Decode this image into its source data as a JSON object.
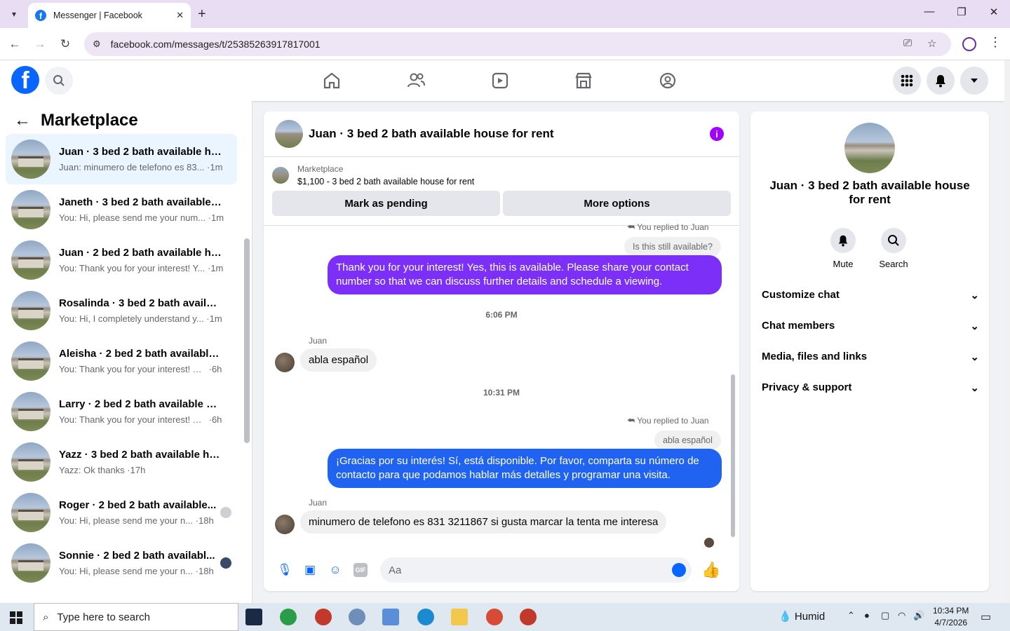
{
  "browser": {
    "tab_title": "Messenger | Facebook",
    "url": "facebook.com/messages/t/25385263917817001"
  },
  "left": {
    "title": "Marketplace",
    "conversations": [
      {
        "name": "Juan · 3 bed 2 bath available ho...",
        "preview": "Juan: minumero de telefono es 83...",
        "time": "1m",
        "active": true
      },
      {
        "name": "Janeth · 3 bed 2 bath available h...",
        "preview": "You: Hi, please send me your num...",
        "time": "1m"
      },
      {
        "name": "Juan · 2 bed 2 bath available ho...",
        "preview": "You: Thank you for your interest! Y...",
        "time": "1m"
      },
      {
        "name": "Rosalinda · 3 bed 2 bath availabl...",
        "preview": "You: Hi, I completely understand y...",
        "time": "1m"
      },
      {
        "name": "Aleisha · 2 bed 2 bath available ...",
        "preview": "You: Thank you for your interest! Ye...",
        "time": "6h"
      },
      {
        "name": "Larry · 2 bed 2 bath available ho...",
        "preview": "You: Thank you for your interest! Ye...",
        "time": "6h"
      },
      {
        "name": "Yazz · 3 bed 2 bath available ho...",
        "preview": "Yazz: Ok thanks",
        "time": "17h"
      },
      {
        "name": "Roger · 2 bed 2 bath available...",
        "preview": "You: Hi, please send me your n...",
        "time": "18h"
      },
      {
        "name": "Sonnie · 2 bed 2 bath availabl...",
        "preview": "You: Hi, please send me your n...",
        "time": "18h"
      }
    ]
  },
  "chat": {
    "title": "Juan · 3 bed 2 bath available house for rent",
    "listing_source": "Marketplace",
    "listing_text": "$1,100 - 3 bed 2 bath available house for rent",
    "btn_pending": "Mark as pending",
    "btn_more": "More options",
    "reply_label_1": "You replied to Juan",
    "quoted_1": "Is this still available?",
    "out_1": "Thank you for your interest! Yes, this is available. Please share your contact number so that we can discuss further details and schedule a viewing.",
    "time_1": "6:06 PM",
    "sender_1": "Juan",
    "in_1": "abla español",
    "time_2": "10:31 PM",
    "reply_label_2": "You replied to Juan",
    "quoted_2": "abla español",
    "out_2": "¡Gracias por su interés! Sí, está disponible. Por favor, comparta su número de contacto para que podamos hablar más detalles y programar una visita.",
    "sender_2": "Juan",
    "in_2": "minumero de telefono es 831 3211867 si gusta marcar la tenta me interesa",
    "composer_placeholder": "Aa",
    "out_color_1": "#7b2ff7",
    "out_color_2": "#1f63f0"
  },
  "right": {
    "name": "Juan · 3 bed 2 bath available house for rent",
    "mute": "Mute",
    "search": "Search",
    "sections": [
      "Customize chat",
      "Chat members",
      "Media, files and links",
      "Privacy & support"
    ]
  },
  "taskbar": {
    "search_placeholder": "Type here to search",
    "weather": "Humid",
    "time": "10:34 PM",
    "date": "4/7/2026"
  }
}
